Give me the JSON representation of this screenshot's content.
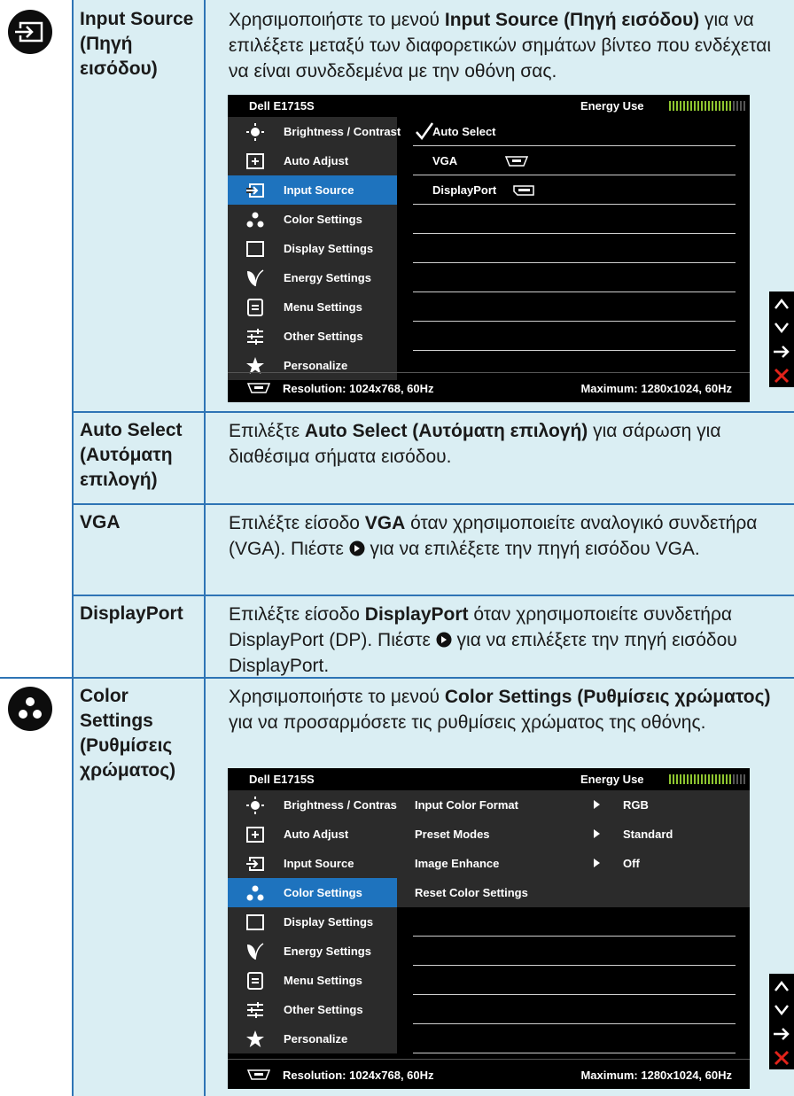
{
  "rows": {
    "input_source": {
      "icon": "input-source-icon",
      "label": "Input Source (Πηγή εισόδου)",
      "desc_a": "Χρησιμοποιήστε το μενού ",
      "desc_bold": "Input Source (Πηγή εισόδου)",
      "desc_b": " για να επιλέξετε μεταξύ των διαφορετικών σημάτων βίντεο που ενδέχεται να είναι συνδεδεμένα με την οθόνη σας."
    },
    "auto_select": {
      "label": "Auto Select (Αυτόματη επιλογή)",
      "desc_a": "Επιλέξτε ",
      "desc_bold": "Auto Select (Αυτόματη επιλογή)",
      "desc_b": " για σάρωση για διαθέσιμα σήματα εισόδου."
    },
    "vga": {
      "label": "VGA",
      "desc_a": "Επιλέξτε είσοδο ",
      "desc_bold": "VGA",
      "desc_b": " όταν χρησιμοποιείτε αναλογικό συνδετήρα (VGA). Πιέστε ",
      "desc_c": " για να επιλέξετε την πηγή εισόδου VGA."
    },
    "displayport": {
      "label": "DisplayPort",
      "desc_a": "Επιλέξτε είσοδο ",
      "desc_bold": "DisplayPort",
      "desc_b": " όταν χρησιμοποιείτε συνδετήρα DisplayPort (DP). Πιέστε ",
      "desc_c": " για να επιλέξετε την πηγή εισόδου DisplayPort."
    },
    "color_settings": {
      "icon": "color-settings-icon",
      "label": "Color Settings (Ρυθμίσεις χρώματος)",
      "desc_a": "Χρησιμοποιήστε το μενού ",
      "desc_bold": "Color Settings (Ρυθμίσεις χρώματος)",
      "desc_b": " για να προσαρμόσετε τις ρυθμίσεις χρώματος της οθόνης."
    }
  },
  "osd": {
    "model": "Dell E1715S",
    "energy_label": "Energy Use",
    "energy_level": 0.8,
    "menu": [
      {
        "label": "Brightness / Contrast",
        "icon": "brightness-icon"
      },
      {
        "label": "Auto Adjust",
        "icon": "auto-adjust-icon"
      },
      {
        "label": "Input Source",
        "icon": "input-source-icon"
      },
      {
        "label": "Color Settings",
        "icon": "color-settings-icon"
      },
      {
        "label": "Display Settings",
        "icon": "display-settings-icon"
      },
      {
        "label": "Energy Settings",
        "icon": "energy-leaf-icon"
      },
      {
        "label": "Menu Settings",
        "icon": "menu-settings-icon"
      },
      {
        "label": "Other Settings",
        "icon": "other-settings-icon"
      },
      {
        "label": "Personalize",
        "icon": "star-icon"
      }
    ],
    "resolution": "Resolution: 1024x768, 60Hz",
    "maximum": "Maximum: 1280x1024, 60Hz",
    "input_panel": {
      "auto_select": "Auto Select",
      "vga": "VGA",
      "displayport": "DisplayPort"
    },
    "color_panel": [
      {
        "name": "Input Color Format",
        "value": "RGB"
      },
      {
        "name": "Preset Modes",
        "value": "Standard"
      },
      {
        "name": "Image Enhance",
        "value": "Off"
      },
      {
        "name": "Reset Color Settings",
        "value": ""
      }
    ]
  },
  "side_controls": [
    "up-arrow-icon",
    "down-arrow-icon",
    "right-arrow-icon",
    "close-icon"
  ]
}
